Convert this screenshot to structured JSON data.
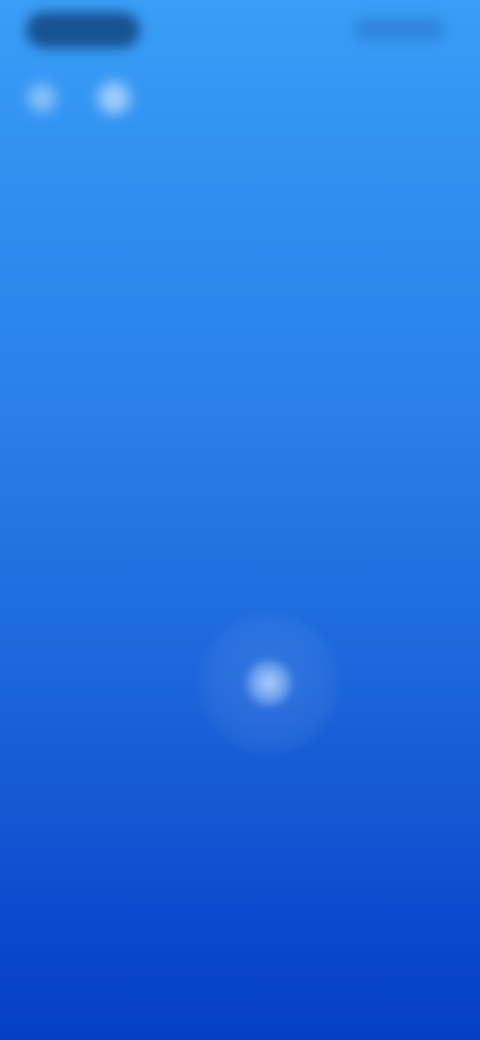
{
  "screen": {
    "background_top": "#3a9ef6",
    "background_bottom": "#0340c6"
  },
  "status_bar": {
    "left_pill_icon": "time-pill",
    "right_icons": "status-indicators"
  },
  "top_bar": {
    "icons": [
      "back-icon",
      "menu-icon"
    ]
  },
  "touch": {
    "icon": "touch-ripple"
  }
}
